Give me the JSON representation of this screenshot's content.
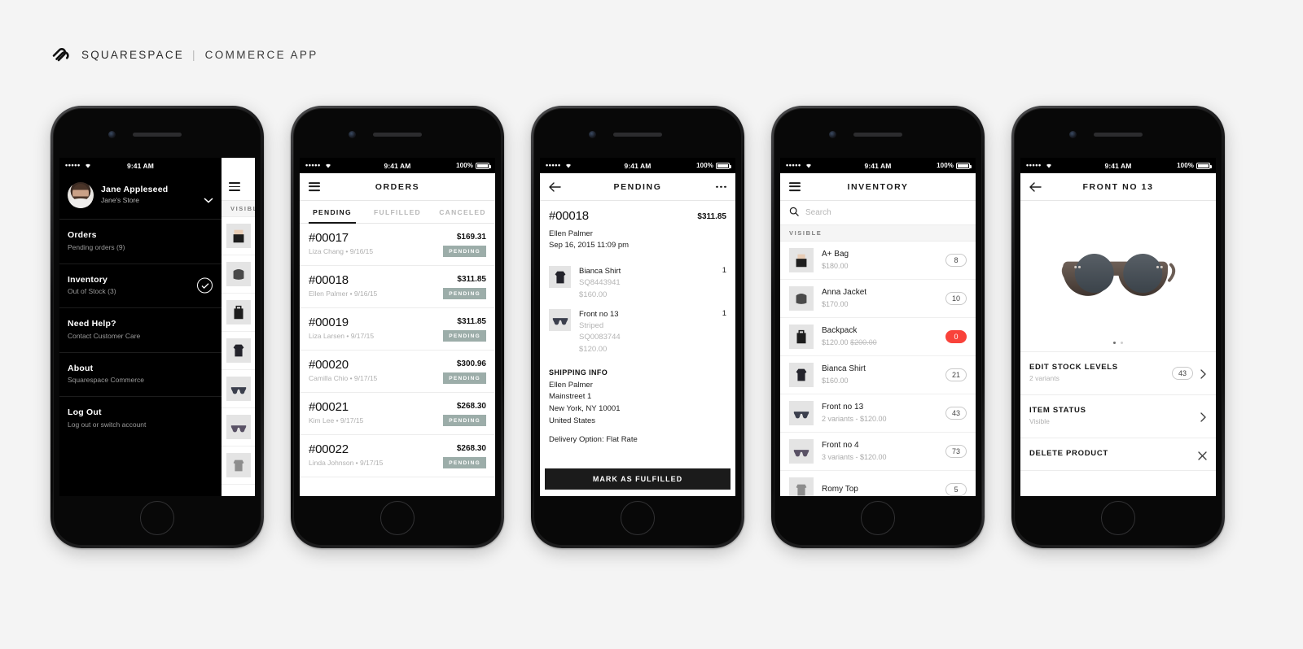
{
  "brand": {
    "logo_icon": "squarespace-logo-icon",
    "name": "SQUARESPACE",
    "separator": "|",
    "product": "COMMERCE APP"
  },
  "status_bar": {
    "signal": "•••••",
    "wifi_icon": "wifi-icon",
    "time": "9:41 AM",
    "battery_percent": "100%",
    "battery_icon": "battery-full-icon"
  },
  "phone1": {
    "label": "menu-drawer-screen",
    "drawer": {
      "avatar_icon": "user-avatar",
      "user_name": "Jane Appleseed",
      "store_name": "Jane's Store",
      "chevron_icon": "chevron-down-icon",
      "items": [
        {
          "title": "Orders",
          "subtitle": "Pending orders (9)",
          "checked": false
        },
        {
          "title": "Inventory",
          "subtitle": "Out of Stock (3)",
          "checked": true,
          "check_icon": "check-circle-icon"
        },
        {
          "title": "Need Help?",
          "subtitle": "Contact Customer Care",
          "checked": false
        },
        {
          "title": "About",
          "subtitle": "Squarespace Commerce",
          "checked": false
        },
        {
          "title": "Log Out",
          "subtitle": "Log out or switch account",
          "checked": false
        }
      ]
    },
    "peek": {
      "menu_icon": "hamburger-menu-icon",
      "section": "VISIBLE",
      "thumbs": [
        "bag-icon",
        "jacket-icon",
        "backpack-icon",
        "shirt-icon",
        "sunglasses-icon",
        "sunglasses-icon",
        "top-icon"
      ]
    }
  },
  "phone2": {
    "label": "orders-list-screen",
    "menu_icon": "hamburger-menu-icon",
    "title": "ORDERS",
    "tabs": [
      {
        "label": "PENDING",
        "active": true
      },
      {
        "label": "FULFILLED",
        "active": false
      },
      {
        "label": "CANCELED",
        "active": false
      }
    ],
    "orders": [
      {
        "id": "#00017",
        "customer": "Liza Chang",
        "date": "9/16/15",
        "price": "$169.31",
        "status": "PENDING"
      },
      {
        "id": "#00018",
        "customer": "Ellen Palmer",
        "date": "9/16/15",
        "price": "$311.85",
        "status": "PENDING"
      },
      {
        "id": "#00019",
        "customer": "Liza Larsen",
        "date": "9/17/15",
        "price": "$311.85",
        "status": "PENDING"
      },
      {
        "id": "#00020",
        "customer": "Camilla Chio",
        "date": "9/17/15",
        "price": "$300.96",
        "status": "PENDING"
      },
      {
        "id": "#00021",
        "customer": "Kim Lee",
        "date": "9/17/15",
        "price": "$268.30",
        "status": "PENDING"
      },
      {
        "id": "#00022",
        "customer": "Linda Johnson",
        "date": "9/17/15",
        "price": "$268.30",
        "status": "PENDING"
      }
    ],
    "separator": "•"
  },
  "phone3": {
    "label": "order-detail-screen",
    "back_icon": "back-arrow-icon",
    "title": "PENDING",
    "more_icon": "more-options-icon",
    "order_id": "#00018",
    "order_total": "$311.85",
    "customer": "Ellen Palmer",
    "date": "Sep 16, 2015 11:09 pm",
    "items": [
      {
        "thumb": "shirt-icon",
        "name": "Bianca Shirt",
        "variant": "",
        "sku": "SQ8443941",
        "price": "$160.00",
        "qty": "1"
      },
      {
        "thumb": "sunglasses-icon",
        "name": "Front no 13",
        "variant": "Striped",
        "sku": "SQ0083744",
        "price": "$120.00",
        "qty": "1"
      }
    ],
    "shipping_title": "SHIPPING INFO",
    "shipping_lines": [
      "Ellen Palmer",
      "Mainstreet 1",
      "New York, NY 10001",
      "United States"
    ],
    "delivery": "Delivery Option: Flat Rate",
    "cta": "MARK AS FULFILLED"
  },
  "phone4": {
    "label": "inventory-list-screen",
    "menu_icon": "hamburger-menu-icon",
    "title": "INVENTORY",
    "search_icon": "search-icon",
    "search_placeholder": "Search",
    "section": "VISIBLE",
    "items": [
      {
        "thumb": "bag-icon",
        "name": "A+ Bag",
        "sub": "$180.00",
        "sub_strike": "",
        "qty": "8",
        "out": false
      },
      {
        "thumb": "jacket-icon",
        "name": "Anna Jacket",
        "sub": "$170.00",
        "sub_strike": "",
        "qty": "10",
        "out": false
      },
      {
        "thumb": "backpack-icon",
        "name": "Backpack",
        "sub": "$120.00",
        "sub_strike": "$200.00",
        "qty": "0",
        "out": true
      },
      {
        "thumb": "shirt-icon",
        "name": "Bianca Shirt",
        "sub": "$160.00",
        "sub_strike": "",
        "qty": "21",
        "out": false
      },
      {
        "thumb": "sunglasses-icon",
        "name": "Front no 13",
        "sub": "2 variants - $120.00",
        "sub_strike": "",
        "qty": "43",
        "out": false
      },
      {
        "thumb": "sunglasses-icon",
        "name": "Front no 4",
        "sub": "3 variants - $120.00",
        "sub_strike": "",
        "qty": "73",
        "out": false
      },
      {
        "thumb": "top-icon",
        "name": "Romy Top",
        "sub": "",
        "sub_strike": "",
        "qty": "5",
        "out": false
      }
    ]
  },
  "phone5": {
    "label": "product-detail-screen",
    "back_icon": "back-arrow-icon",
    "title": "FRONT NO 13",
    "hero_icon": "sunglasses-photo",
    "page_dots": 2,
    "active_dot": 0,
    "rows": [
      {
        "title": "EDIT STOCK LEVELS",
        "sub": "2 variants",
        "pill": "43",
        "accessory": "chevron-right-icon"
      },
      {
        "title": "ITEM STATUS",
        "sub": "Visible",
        "pill": "",
        "accessory": "chevron-right-icon"
      },
      {
        "title": "DELETE PRODUCT",
        "sub": "",
        "pill": "",
        "accessory": "close-icon"
      }
    ]
  },
  "colors": {
    "background": "#f4f4f4",
    "pending_badge": "#9cada9",
    "out_of_stock": "#f9423a",
    "dark": "#000000",
    "cta": "#1b1b1b"
  }
}
